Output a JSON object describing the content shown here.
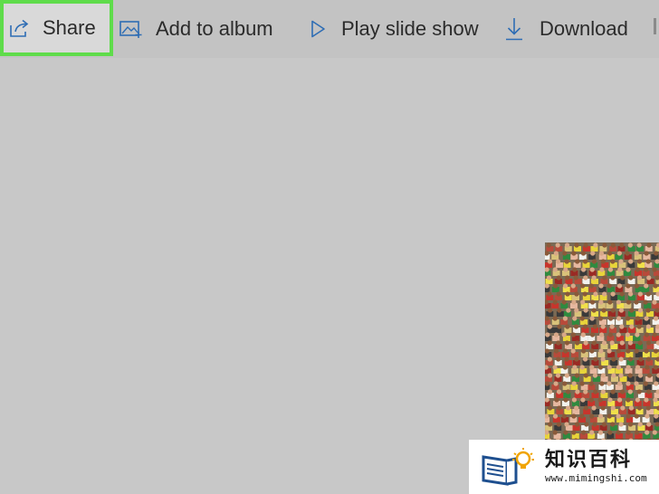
{
  "toolbar": {
    "share_label": "Share",
    "add_to_album_label": "Add to album",
    "play_slide_show_label": "Play slide show",
    "download_label": "Download",
    "icons": {
      "share": "share-icon",
      "add_to_album": "add-to-album-icon",
      "play_slide_show": "play-icon",
      "download": "download-icon"
    },
    "highlighted_button": "share",
    "highlight_color": "#5fdc4b",
    "icon_color": "#2e6db4"
  },
  "canvas": {
    "background_color": "#c8c8c8"
  },
  "watermark": {
    "title": "知识百科",
    "url": "www.mimingshi.com"
  }
}
